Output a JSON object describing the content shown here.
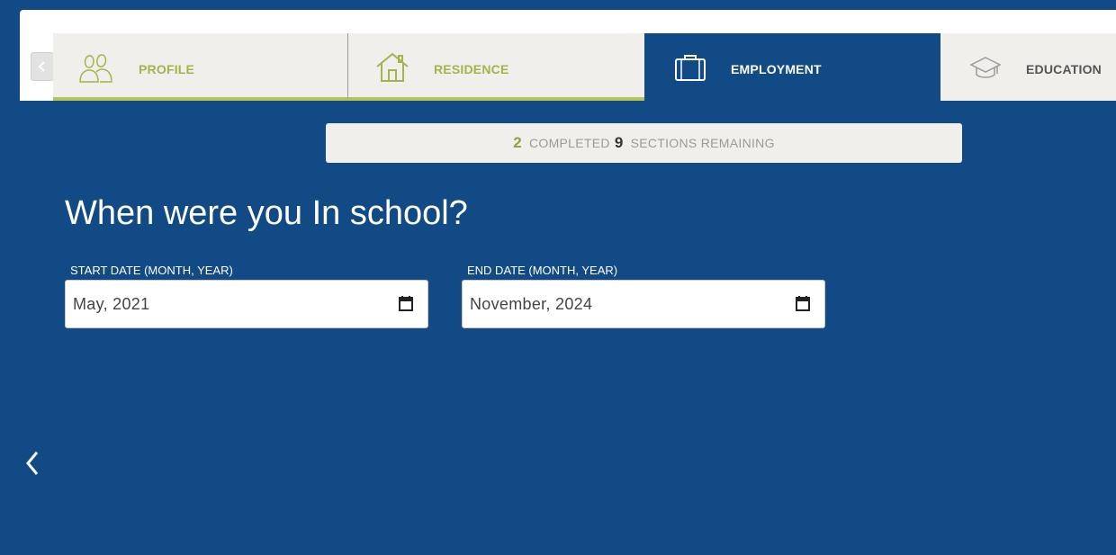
{
  "tabs": [
    {
      "label": "PROFILE",
      "icon": "users-icon",
      "state": "completed"
    },
    {
      "label": "RESIDENCE",
      "icon": "house-icon",
      "state": "completed"
    },
    {
      "label": "EMPLOYMENT",
      "icon": "briefcase-icon",
      "state": "active"
    },
    {
      "label": "EDUCATION",
      "icon": "graduation-cap-icon",
      "state": "pending"
    }
  ],
  "progress": {
    "completed_count": "2",
    "completed_label": "COMPLETED",
    "remaining_count": "9",
    "remaining_label": "SECTIONS REMAINING"
  },
  "question": {
    "title": "When were you In school?"
  },
  "fields": {
    "start_date": {
      "label": "START DATE (MONTH, YEAR)",
      "value": "May, 2021"
    },
    "end_date": {
      "label": "END DATE (MONTH, YEAR)",
      "value": "November, 2024"
    }
  },
  "colors": {
    "background": "#124a85",
    "accent_green": "#b4c45a",
    "tab_inactive": "#f0efeb",
    "text_white": "#ffffff"
  },
  "icons": {
    "scroll_left": "chevron-left-icon",
    "back": "chevron-left-icon",
    "calendar": "calendar-icon"
  }
}
